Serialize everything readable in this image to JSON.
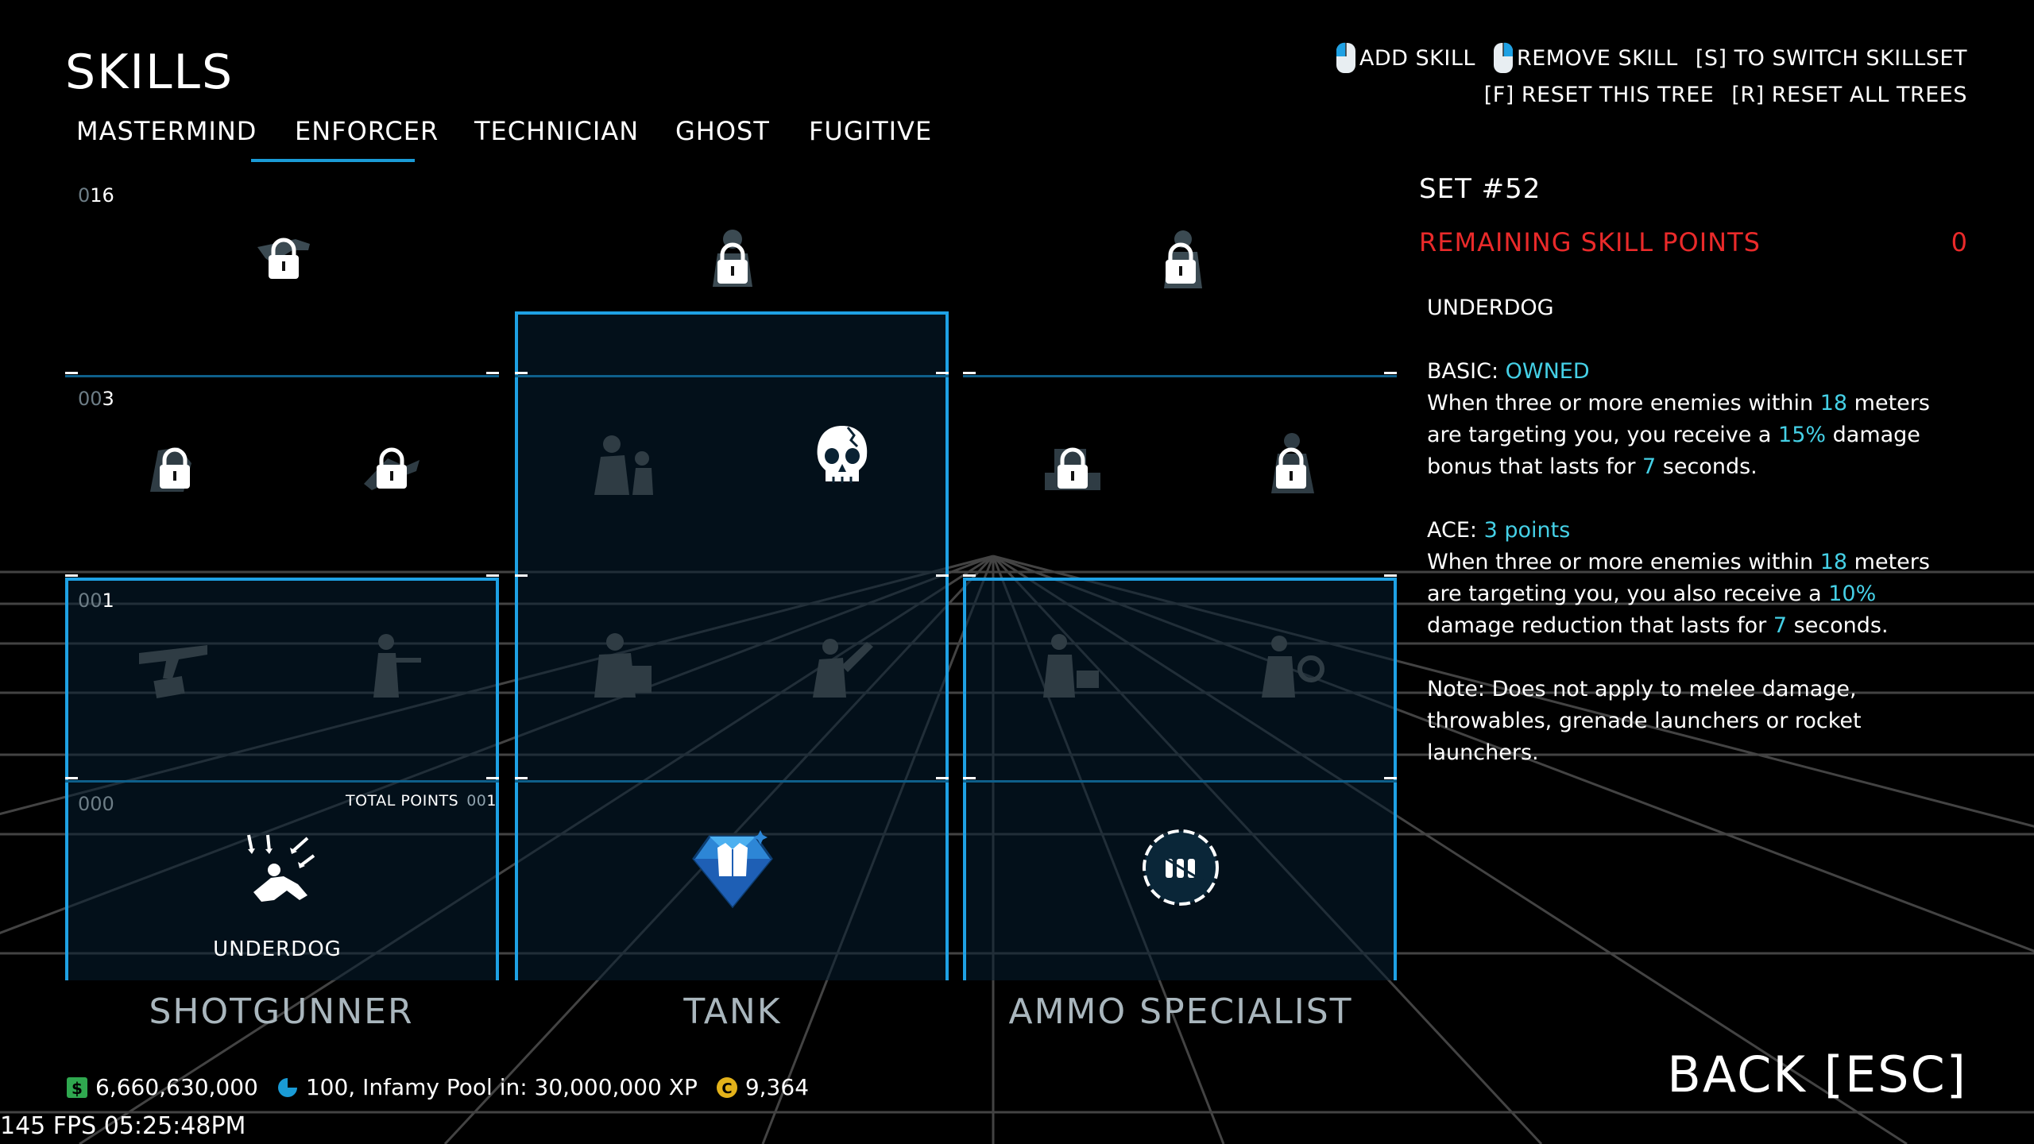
{
  "header": {
    "title": "SKILLS"
  },
  "tabs": [
    {
      "label": "MASTERMIND"
    },
    {
      "label": "ENFORCER",
      "active": true
    },
    {
      "label": "TECHNICIAN"
    },
    {
      "label": "GHOST"
    },
    {
      "label": "FUGITIVE"
    }
  ],
  "hints": {
    "add_skill": "ADD SKILL",
    "remove_skill": "REMOVE SKILL",
    "switch_skillset": "[S] TO SWITCH SKILLSET",
    "reset_tree": "[F] RESET THIS TREE",
    "reset_all": "[R] RESET ALL TREES"
  },
  "tiers": [
    {
      "prefix": "0",
      "value": "16"
    },
    {
      "prefix": "00",
      "value": "3"
    },
    {
      "prefix": "00",
      "value": "1"
    },
    {
      "prefix": "000",
      "value": ""
    }
  ],
  "columns": [
    {
      "name": "SHOTGUNNER",
      "total_points_label": "TOTAL POINTS",
      "total_points_prefix": "00",
      "total_points_value": "1",
      "base_skill_name": "UNDERDOG"
    },
    {
      "name": "TANK"
    },
    {
      "name": "AMMO SPECIALIST"
    }
  ],
  "panel": {
    "set_label": "SET #52",
    "remaining_label": "REMAINING SKILL POINTS",
    "remaining_value": "0",
    "skill_name": "UNDERDOG",
    "basic_label": "BASIC: ",
    "basic_status": "OWNED",
    "basic_t1": "When three or more enemies within ",
    "basic_v1": "18",
    "basic_t2": " meters are targeting you, you receive a ",
    "basic_v2": "15%",
    "basic_t3": " damage bonus that lasts for ",
    "basic_v3": "7",
    "basic_t4": " seconds.",
    "ace_label": "ACE: ",
    "ace_cost": "3 points",
    "ace_t1": "When three or more enemies within ",
    "ace_v1": "18",
    "ace_t2": " meters are targeting you, you also receive a ",
    "ace_v2": "10%",
    "ace_t3": " damage reduction that lasts for ",
    "ace_v3": "7",
    "ace_t4": " seconds.",
    "note": "Note: Does not apply to melee damage, throwables, grenade launchers or rocket launchers."
  },
  "footer": {
    "money": "6,660,630,000",
    "infamy": "100, Infamy Pool in: 30,000,000 XP",
    "coins": "9,364",
    "back_label": "BACK [ESC]",
    "fps": "145 FPS 05:25:48PM"
  },
  "colors": {
    "accent": "#1ea1e4",
    "highlight": "#45d0e6",
    "alert": "#ea2a2a",
    "money": "#2fa84f",
    "coin": "#e3b21a"
  }
}
